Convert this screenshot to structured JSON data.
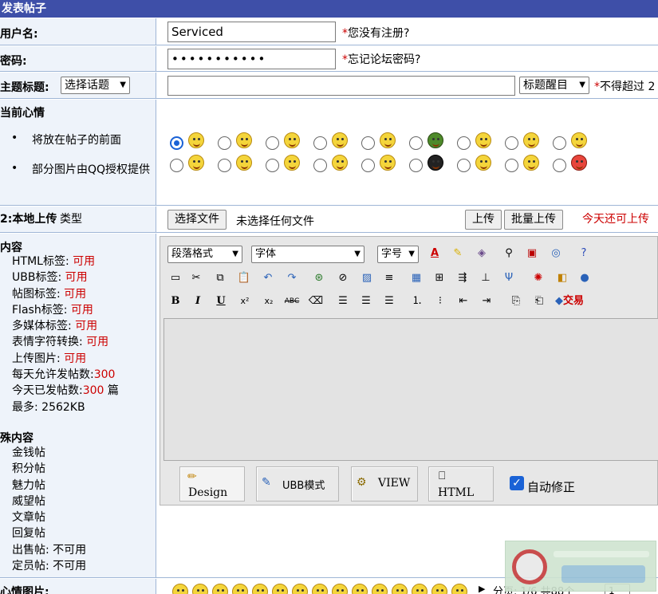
{
  "header": {
    "title": "发表帖子"
  },
  "username": {
    "label": "用户名:",
    "value": "Serviced",
    "hint_star": "*",
    "hint": "您没有注册?"
  },
  "password": {
    "label": "密码:",
    "value": "•••••••••••",
    "hint_star": "*",
    "hint": "忘记论坛密码?"
  },
  "subject": {
    "label": "主题标题:",
    "topic_select": "选择话题",
    "value": "",
    "title_select": "标题醒目",
    "hint_star": "*",
    "hint": "不得超过 2"
  },
  "mood": {
    "label": "当前心情",
    "notes": [
      "将放在帖子的前面",
      "部分图片由QQ授权提供"
    ]
  },
  "upload": {
    "label": "2:本地上传",
    "label_suffix": "类型",
    "choose_button": "选择文件",
    "no_file": "未选择任何文件",
    "upload_button": "上传",
    "batch_button": "批量上传",
    "today_text": "今天还可上传"
  },
  "content": {
    "label": "内容",
    "rules": [
      {
        "name": "HTML标签:",
        "value": "可用"
      },
      {
        "name": "UBB标签:",
        "value": "可用"
      },
      {
        "name": "帖图标签:",
        "value": "可用"
      },
      {
        "name": "Flash标签:",
        "value": "可用"
      },
      {
        "name": "多媒体标签:",
        "value": "可用"
      },
      {
        "name": "表情字符转换:",
        "value": "可用"
      },
      {
        "name": "上传图片:",
        "value": "可用"
      },
      {
        "name": "每天允许发帖数:",
        "value": "300"
      },
      {
        "name": "今天已发帖数:",
        "value": "300",
        "suffix": "篇"
      },
      {
        "name": "最多:",
        "value": "2562KB"
      }
    ],
    "special_label": "殊内容",
    "special": [
      "金钱帖",
      "积分帖",
      "魅力帖",
      "威望帖",
      "文章帖",
      "回复帖"
    ],
    "sale": {
      "name": "出售帖:",
      "value": "不可用"
    },
    "member": {
      "name": "定员帖:",
      "value": "不可用"
    }
  },
  "editor": {
    "paragraph_select": "段落格式",
    "font_select": "字体",
    "size_select": "字号",
    "modes": {
      "design": "Design",
      "ubb": "UBB模式",
      "view": "VIEW",
      "html": "HTML"
    },
    "autofix": "自动修正",
    "trade_label": "交易"
  },
  "bottom": {
    "label": "心情图片:",
    "page_text": "分页: 1/6 共88个",
    "page_select": "1"
  }
}
